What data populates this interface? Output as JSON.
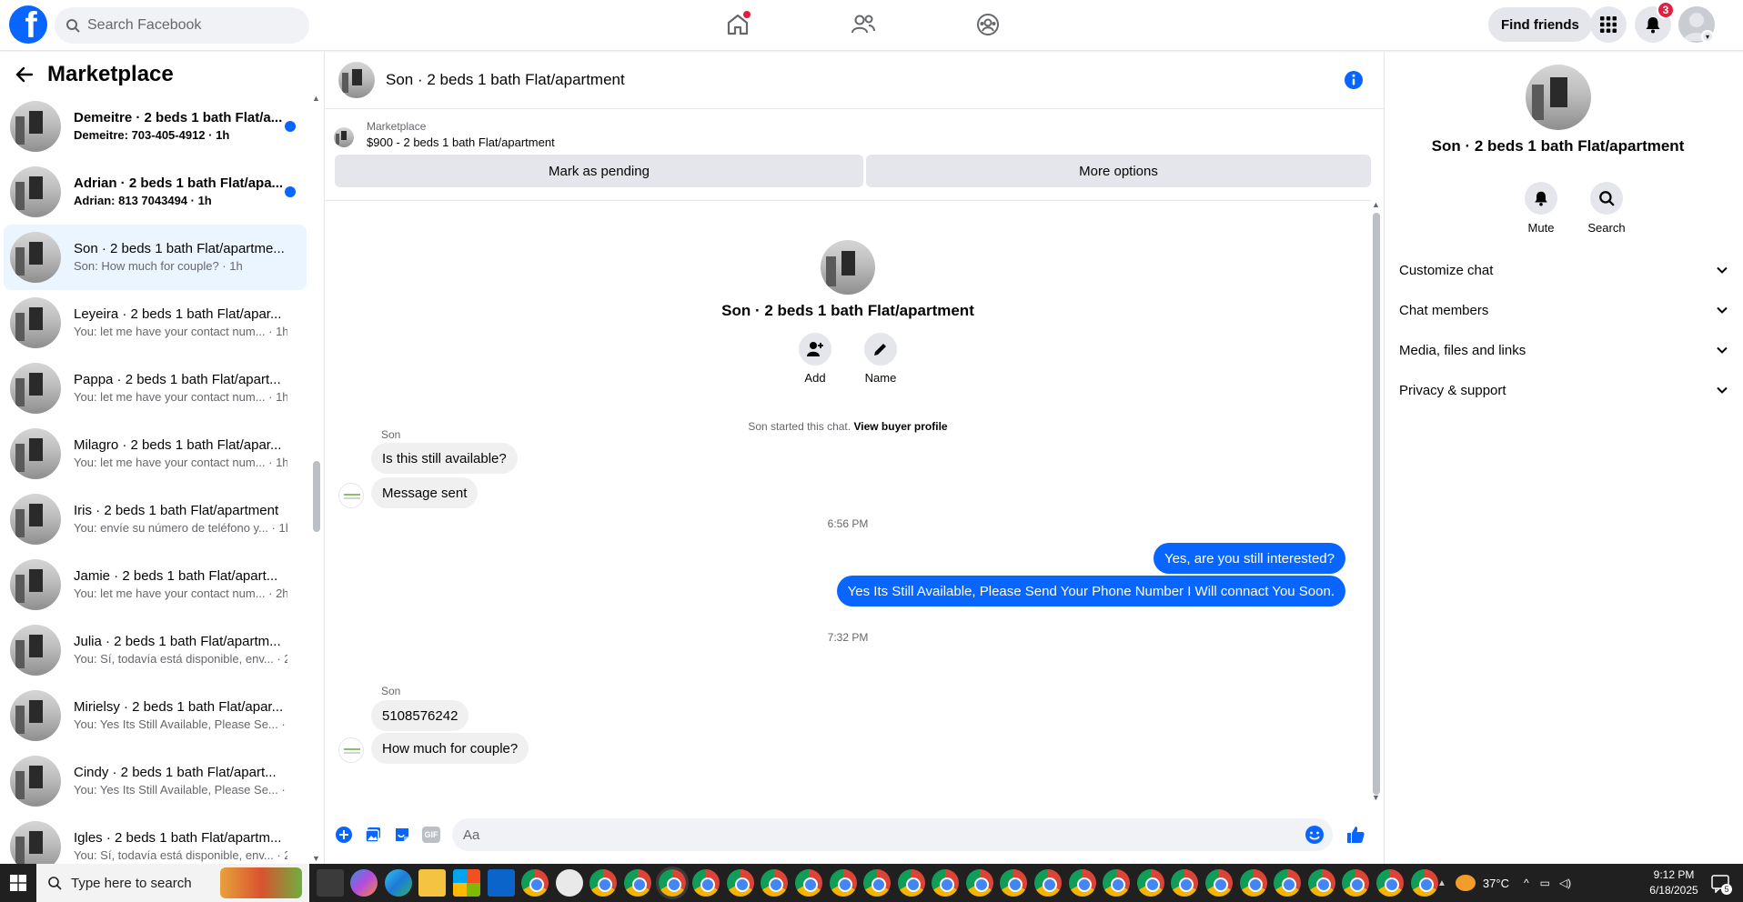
{
  "topbar": {
    "logo": "f",
    "search_placeholder": "Search Facebook",
    "find_friends": "Find friends",
    "notifications_count": "3",
    "icons": [
      "home-icon",
      "friends-icon",
      "groups-icon",
      "menu-grid-icon",
      "bell-icon",
      "account-avatar"
    ]
  },
  "sidebar": {
    "title": "Marketplace",
    "conversations": [
      {
        "title": "Demeitre · 2 beds 1 bath Flat/a...",
        "subtitle": "Demeitre: 703-405-4912 · 1h",
        "unread": true
      },
      {
        "title": "Adrian · 2 beds 1 bath Flat/apa...",
        "subtitle": "Adrian: 813 7043494 · 1h",
        "unread": true
      },
      {
        "title": "Son · 2 beds 1 bath Flat/apartme...",
        "subtitle": "Son: How much for couple? · 1h",
        "active": true
      },
      {
        "title": "Leyeira · 2 beds 1 bath Flat/apar...",
        "subtitle": "You: let me have your contact num... · 1h"
      },
      {
        "title": "Pappa · 2 beds 1 bath Flat/apart...",
        "subtitle": "You: let me have your contact num... · 1h"
      },
      {
        "title": "Milagro · 2 beds 1 bath Flat/apar...",
        "subtitle": "You: let me have your contact num... · 1h"
      },
      {
        "title": "Iris · 2 beds 1 bath Flat/apartment",
        "subtitle": "You: envíe su número de teléfono y... · 1h"
      },
      {
        "title": "Jamie · 2 beds 1 bath Flat/apart...",
        "subtitle": "You: let me have your contact num... · 2h"
      },
      {
        "title": "Julia · 2 beds 1 bath Flat/apartm...",
        "subtitle": "You: Sí, todavía está disponible, env... · 2h"
      },
      {
        "title": "Mirielsy · 2 beds 1 bath Flat/apar...",
        "subtitle": "You: Yes Its Still Available, Please Se... · 2h"
      },
      {
        "title": "Cindy · 2 beds 1 bath Flat/apart...",
        "subtitle": "You: Yes Its Still Available, Please Se... · 2h"
      },
      {
        "title": "Igles · 2 beds 1 bath Flat/apartm...",
        "subtitle": "You: Sí, todavía está disponible, env... · 2h"
      }
    ]
  },
  "chat": {
    "header_title": "Son · 2 beds 1 bath Flat/apartment",
    "listing_source": "Marketplace",
    "listing_price": "$900 - 2 beds 1 bath Flat/apartment",
    "mark_pending": "Mark as pending",
    "more_options": "More options",
    "intro_title": "Son · 2 beds 1 bath Flat/apartment",
    "add_label": "Add",
    "name_label": "Name",
    "started_text": "Son started this chat.",
    "view_profile": "View buyer profile",
    "sender1": "Son",
    "msg1": "Is this still available?",
    "msg2": "Message sent",
    "time1": "6:56 PM",
    "msg3": "Yes, are you still interested?",
    "msg4": "Yes Its Still Available, Please Send Your Phone Number I Will connact You Soon.",
    "time2": "7:32 PM",
    "sender2": "Son",
    "msg5": "5108576242",
    "msg6": "How much for couple?",
    "composer_placeholder": "Aa",
    "gif_label": "GIF"
  },
  "rpanel": {
    "title": "Son · 2 beds 1 bath Flat/apartment",
    "mute": "Mute",
    "search": "Search",
    "sections": [
      "Customize chat",
      "Chat members",
      "Media, files and links",
      "Privacy & support"
    ]
  },
  "taskbar": {
    "search_placeholder": "Type here to search",
    "temperature": "37°C",
    "time": "9:12 PM",
    "date": "6/18/2025",
    "notif_count": "5"
  }
}
